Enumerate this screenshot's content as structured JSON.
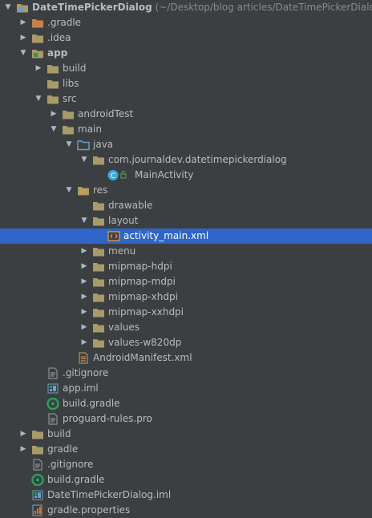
{
  "colors": {
    "background": "#3c3f41",
    "selection": "#2f65ca",
    "folder": "#a89a6a",
    "folder_excluded": "#c8814a",
    "folder_source": "#6a9fc8",
    "class_icon": "#3fa7d6",
    "gradle_icon": "#2aa05a"
  },
  "tree": [
    {
      "level": 0,
      "arrow": "expanded",
      "icon": "project-folder-icon",
      "label": "DateTimePickerDialog",
      "extra": " (~/Desktop/blog articles/DateTimePickerDialog)",
      "bold": true
    },
    {
      "level": 1,
      "arrow": "collapsed",
      "icon": "gradle-folder-icon",
      "label": ".gradle"
    },
    {
      "level": 1,
      "arrow": "collapsed",
      "icon": "folder-icon",
      "label": ".idea"
    },
    {
      "level": 1,
      "arrow": "expanded",
      "icon": "module-folder-icon",
      "label": "app",
      "bold": true
    },
    {
      "level": 2,
      "arrow": "collapsed",
      "icon": "folder-icon",
      "label": "build"
    },
    {
      "level": 2,
      "arrow": "none",
      "icon": "folder-icon",
      "label": "libs"
    },
    {
      "level": 2,
      "arrow": "expanded",
      "icon": "folder-icon",
      "label": "src"
    },
    {
      "level": 3,
      "arrow": "collapsed",
      "icon": "folder-icon",
      "label": "androidTest"
    },
    {
      "level": 3,
      "arrow": "expanded",
      "icon": "folder-icon",
      "label": "main"
    },
    {
      "level": 4,
      "arrow": "expanded",
      "icon": "source-folder-icon",
      "label": "java"
    },
    {
      "level": 5,
      "arrow": "expanded",
      "icon": "package-folder-icon",
      "label": "com.journaldev.datetimepickerdialog"
    },
    {
      "level": 6,
      "arrow": "none",
      "icon": "class-icon",
      "label": "MainActivity"
    },
    {
      "level": 4,
      "arrow": "expanded",
      "icon": "resources-folder-icon",
      "label": "res"
    },
    {
      "level": 5,
      "arrow": "none",
      "icon": "folder-icon",
      "label": "drawable"
    },
    {
      "level": 5,
      "arrow": "expanded",
      "icon": "folder-icon",
      "label": "layout"
    },
    {
      "level": 6,
      "arrow": "none",
      "icon": "xml-file-icon",
      "label": "activity_main.xml",
      "selected": true
    },
    {
      "level": 5,
      "arrow": "collapsed",
      "icon": "folder-icon",
      "label": "menu"
    },
    {
      "level": 5,
      "arrow": "collapsed",
      "icon": "folder-icon",
      "label": "mipmap-hdpi"
    },
    {
      "level": 5,
      "arrow": "collapsed",
      "icon": "folder-icon",
      "label": "mipmap-mdpi"
    },
    {
      "level": 5,
      "arrow": "collapsed",
      "icon": "folder-icon",
      "label": "mipmap-xhdpi"
    },
    {
      "level": 5,
      "arrow": "collapsed",
      "icon": "folder-icon",
      "label": "mipmap-xxhdpi"
    },
    {
      "level": 5,
      "arrow": "collapsed",
      "icon": "folder-icon",
      "label": "values"
    },
    {
      "level": 5,
      "arrow": "collapsed",
      "icon": "folder-icon",
      "label": "values-w820dp"
    },
    {
      "level": 4,
      "arrow": "none",
      "icon": "manifest-file-icon",
      "label": "AndroidManifest.xml"
    },
    {
      "level": 2,
      "arrow": "none",
      "icon": "text-file-icon",
      "label": ".gitignore"
    },
    {
      "level": 2,
      "arrow": "none",
      "icon": "iml-file-icon",
      "label": "app.iml"
    },
    {
      "level": 2,
      "arrow": "none",
      "icon": "gradle-file-icon",
      "label": "build.gradle"
    },
    {
      "level": 2,
      "arrow": "none",
      "icon": "text-file-icon",
      "label": "proguard-rules.pro"
    },
    {
      "level": 1,
      "arrow": "collapsed",
      "icon": "folder-icon",
      "label": "build"
    },
    {
      "level": 1,
      "arrow": "collapsed",
      "icon": "folder-icon",
      "label": "gradle"
    },
    {
      "level": 1,
      "arrow": "none",
      "icon": "text-file-icon",
      "label": ".gitignore"
    },
    {
      "level": 1,
      "arrow": "none",
      "icon": "gradle-file-icon",
      "label": "build.gradle"
    },
    {
      "level": 1,
      "arrow": "none",
      "icon": "iml-file-icon",
      "label": "DateTimePickerDialog.iml"
    },
    {
      "level": 1,
      "arrow": "none",
      "icon": "properties-file-icon",
      "label": "gradle.properties"
    }
  ]
}
